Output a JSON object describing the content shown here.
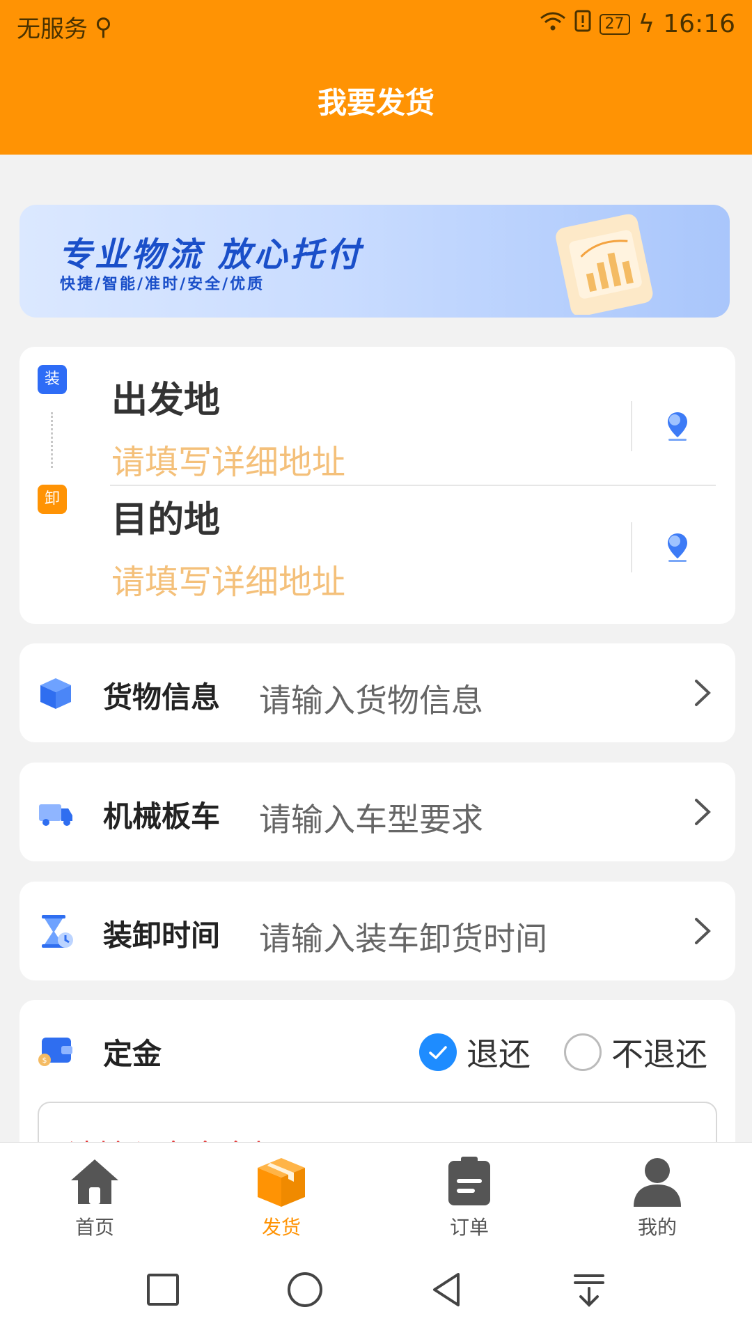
{
  "status_bar": {
    "carrier": "无服务",
    "battery": "27",
    "time": "16:16"
  },
  "header": {
    "title": "我要发货"
  },
  "banner": {
    "title": "专业物流  放心托付",
    "subtitle": "快捷/智能/准时/安全/优质"
  },
  "address": {
    "origin": {
      "tag": "装",
      "label": "出发地",
      "placeholder": "请填写详细地址"
    },
    "destination": {
      "tag": "卸",
      "label": "目的地",
      "placeholder": "请填写详细地址"
    }
  },
  "rows": [
    {
      "label": "货物信息",
      "placeholder": "请输入货物信息",
      "icon": "cargo-box-icon"
    },
    {
      "label": "机械板车",
      "placeholder": "请输入车型要求",
      "icon": "truck-icon"
    },
    {
      "label": "装卸时间",
      "placeholder": "请输入装车卸货时间",
      "icon": "hourglass-icon"
    }
  ],
  "deposit": {
    "label": "定金",
    "option_refund": "退还",
    "option_no_refund": "不退还",
    "selected": "退还",
    "input_placeholder": "请输入定金金额"
  },
  "tabs": [
    {
      "label": "首页",
      "icon": "home-icon",
      "active": false
    },
    {
      "label": "发货",
      "icon": "package-icon",
      "active": true
    },
    {
      "label": "订单",
      "icon": "order-icon",
      "active": false
    },
    {
      "label": "我的",
      "icon": "user-icon",
      "active": false
    }
  ],
  "colors": {
    "brand": "#ff9304",
    "blue": "#1e8cff",
    "hint_orange": "#f4c07a",
    "required_red": "#e23b3b"
  }
}
